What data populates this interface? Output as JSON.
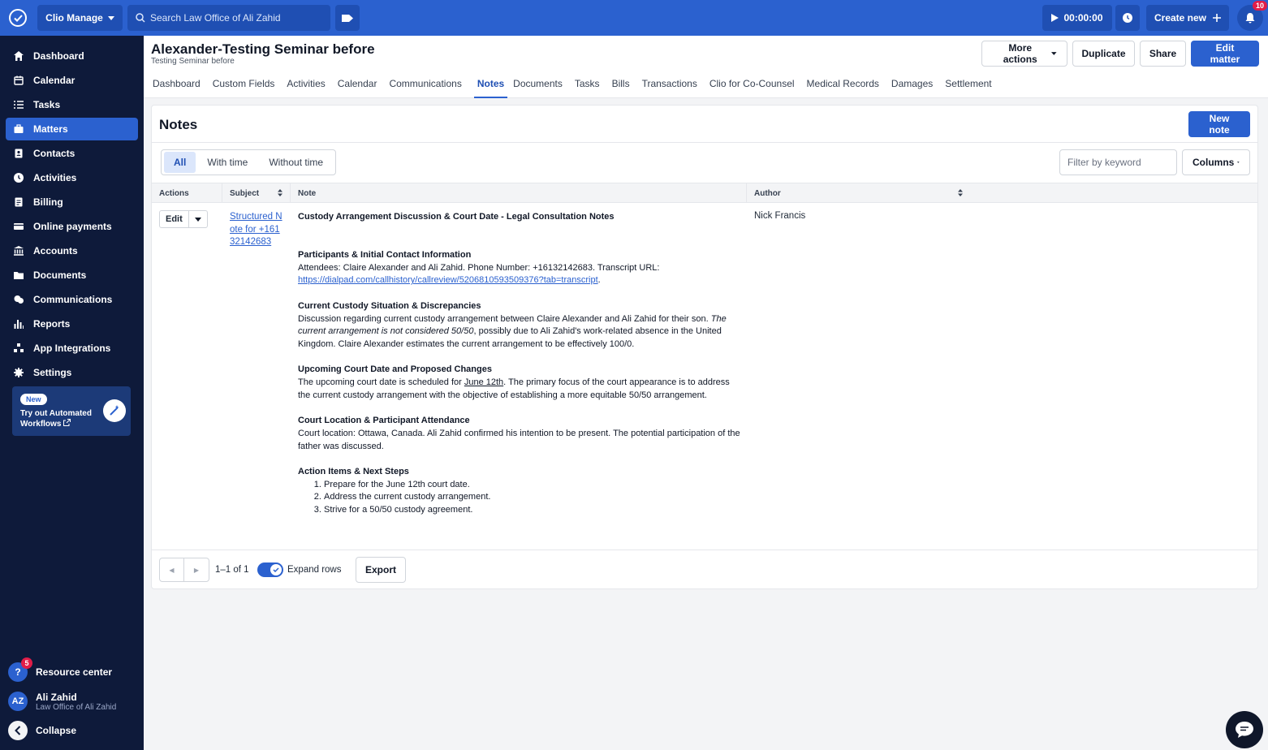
{
  "topbar": {
    "app_switcher": "Clio Manage",
    "search_placeholder": "Search Law Office of Ali Zahid",
    "timer": "00:00:00",
    "create_new": "Create new",
    "notification_count": "10"
  },
  "sidebar": {
    "items": [
      {
        "label": "Dashboard",
        "icon": "home-icon"
      },
      {
        "label": "Calendar",
        "icon": "calendar-icon"
      },
      {
        "label": "Tasks",
        "icon": "tasks-icon"
      },
      {
        "label": "Matters",
        "icon": "briefcase-icon",
        "active": true
      },
      {
        "label": "Contacts",
        "icon": "contacts-icon"
      },
      {
        "label": "Activities",
        "icon": "clock-icon"
      },
      {
        "label": "Billing",
        "icon": "billing-icon"
      },
      {
        "label": "Online payments",
        "icon": "card-icon"
      },
      {
        "label": "Accounts",
        "icon": "bank-icon"
      },
      {
        "label": "Documents",
        "icon": "folder-icon"
      },
      {
        "label": "Communications",
        "icon": "chat-icon"
      },
      {
        "label": "Reports",
        "icon": "chart-icon"
      },
      {
        "label": "App Integrations",
        "icon": "integrations-icon"
      },
      {
        "label": "Settings",
        "icon": "gear-icon"
      }
    ],
    "promo": {
      "badge": "New",
      "text": "Try out Automated Workflows"
    },
    "resource_center": {
      "label": "Resource center",
      "badge": "5"
    },
    "user": {
      "initials": "AZ",
      "name": "Ali Zahid",
      "firm": "Law Office of Ali Zahid"
    },
    "collapse": "Collapse"
  },
  "matter": {
    "title": "Alexander-Testing Seminar before",
    "subtitle": "Testing Seminar before",
    "actions": {
      "more": "More actions",
      "duplicate": "Duplicate",
      "share": "Share",
      "edit": "Edit matter"
    },
    "tabs": [
      "Dashboard",
      "Custom Fields",
      "Activities",
      "Calendar",
      "Communications",
      "Notes",
      "Documents",
      "Tasks",
      "Bills",
      "Transactions",
      "Clio for Co-Counsel",
      "Medical Records",
      "Damages",
      "Settlement"
    ],
    "active_tab": "Notes"
  },
  "notes": {
    "title": "Notes",
    "new_note": "New note",
    "segments": [
      "All",
      "With time",
      "Without time"
    ],
    "filter_placeholder": "Filter by keyword",
    "columns_label": "Columns",
    "headers": {
      "actions": "Actions",
      "subject": "Subject",
      "note": "Note",
      "author": "Author"
    },
    "row": {
      "edit": "Edit",
      "subject": "Structured Note for +16132142683",
      "author": "Nick Francis",
      "note": {
        "title": "Custody Arrangement Discussion & Court Date - Legal Consultation Notes",
        "s1_head": "Participants & Initial Contact Information",
        "s1_text": "Attendees: Claire Alexander and Ali Zahid. Phone Number: +16132142683. Transcript URL:",
        "s1_link": "https://dialpad.com/callhistory/callreview/5206810593509376?tab=transcript",
        "s1_after": ".",
        "s2_head": "Current Custody Situation & Discrepancies",
        "s2_text1": "Discussion regarding current custody arrangement between Claire Alexander and Ali Zahid for their son.",
        "s2_italic": "The current arrangement is not considered 50/50",
        "s2_text2": ", possibly due to Ali Zahid's work-related absence in the United Kingdom. Claire Alexander estimates the current arrangement to be effectively 100/0.",
        "s3_head": "Upcoming Court Date and Proposed Changes",
        "s3_text1": "The upcoming court date is scheduled for ",
        "s3_date": "June 12th",
        "s3_text2": ". The primary focus of the court appearance is to address the current custody arrangement with the objective of establishing a more equitable 50/50 arrangement.",
        "s4_head": "Court Location & Participant Attendance",
        "s4_text": "Court location: Ottawa, Canada. Ali Zahid confirmed his intention to be present. The potential participation of the father was discussed.",
        "s5_head": "Action Items & Next Steps",
        "s5_items": [
          "Prepare for the June 12th court date.",
          "Address the current custody arrangement.",
          "Strive for a 50/50 custody agreement."
        ]
      }
    },
    "range": "1–1 of 1",
    "expand_rows": "Expand rows",
    "export": "Export"
  },
  "colors": {
    "brand": "#2b61cf",
    "sidebar": "#0e1a3a"
  }
}
